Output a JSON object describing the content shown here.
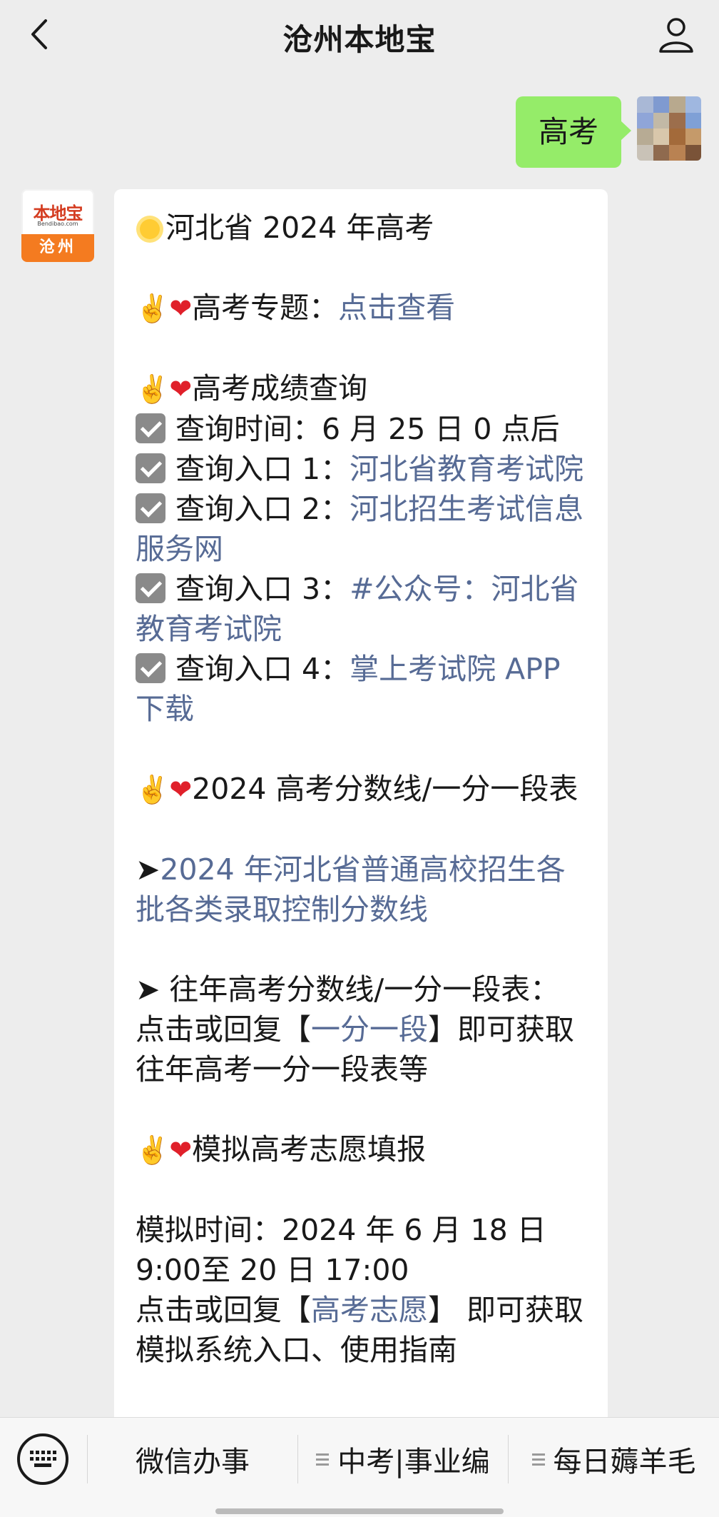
{
  "header": {
    "title": "沧州本地宝",
    "back_icon": "chevron-left-icon",
    "profile_icon": "person-icon"
  },
  "outgoing": {
    "text": "高考"
  },
  "bot": {
    "avatar_logo": "本地宝",
    "avatar_sub": "Bendibao.com",
    "avatar_city": "沧州"
  },
  "message": {
    "line_title": "河北省 2024 年高考",
    "topic_label": "高考专题：",
    "topic_link": "点击查看",
    "score_query_heading": "高考成绩查询",
    "query_time": "查询时间：6 月 25 日 0 点后",
    "entry1_label": "查询入口 1：",
    "entry1_link": "河北省教育考试院",
    "entry2_label": "查询入口 2：",
    "entry2_link": "河北招生考试信息服务网",
    "entry3_label": "查询入口 3：",
    "entry3_link": "#公众号：河北省教育考试院",
    "entry4_label": "查询入口 4：",
    "entry4_link": "掌上考试院 APP 下载",
    "score_line_heading": "2024 高考分数线/一分一段表",
    "arrow1_link": "2024 年河北省普通高校招生各批各类录取控制分数线",
    "arrow2_text_a": "往年高考分数线/一分一段表：点击或回复【",
    "arrow2_link": "一分一段",
    "arrow2_text_b": "】即可获取往年高考一分一段表等",
    "sim_heading": "模拟高考志愿填报",
    "sim_time": "模拟时间：2024 年 6 月 18 日 9:00至 20 日 17:00",
    "sim_text_a": "点击或回复【",
    "sim_link": "高考志愿",
    "sim_text_b": "】 即可获取模拟系统入口、使用指南"
  },
  "bottom_menu": {
    "keyboard_icon": "keyboard-icon",
    "items": [
      {
        "label": "微信办事"
      },
      {
        "label": "中考|事业编"
      },
      {
        "label": "每日薅羊毛"
      }
    ]
  }
}
